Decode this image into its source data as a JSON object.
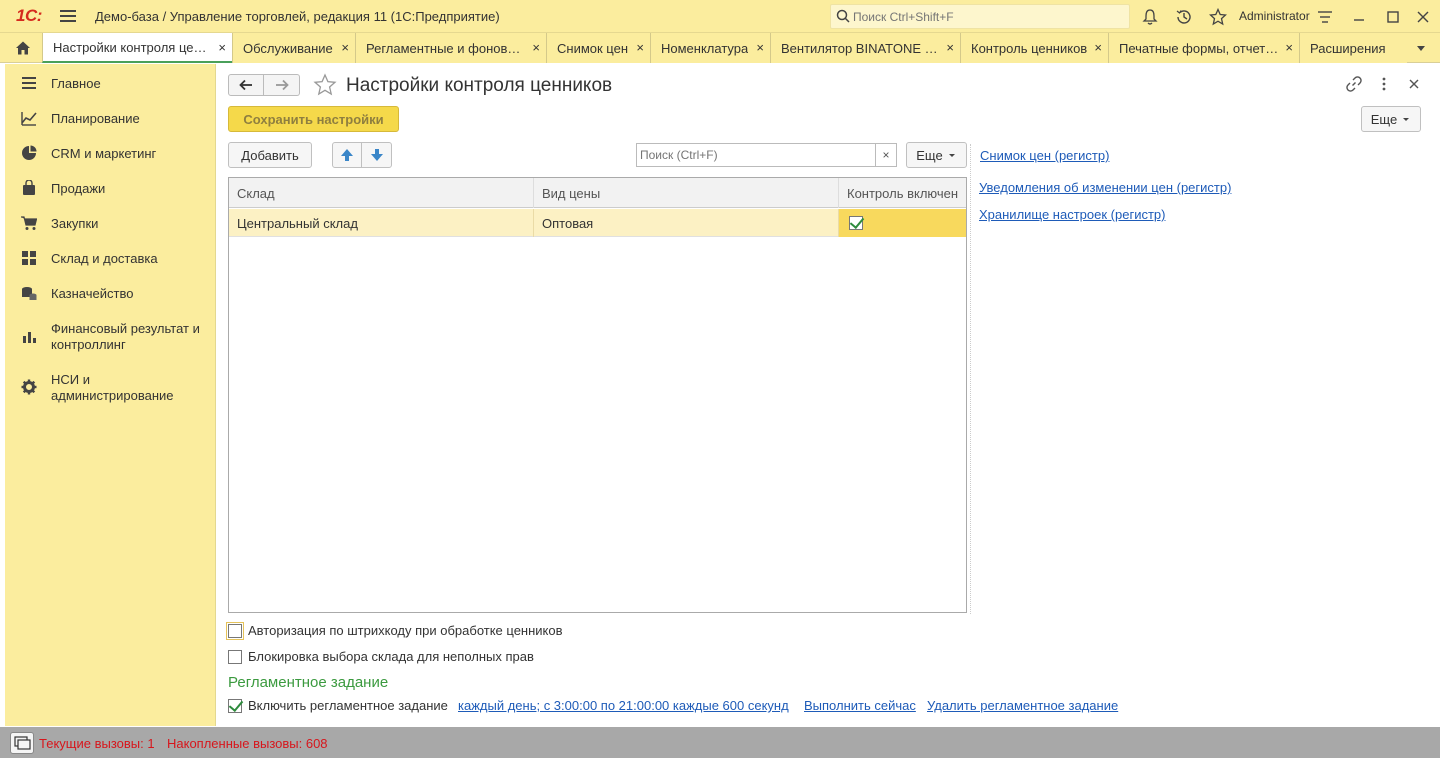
{
  "app": {
    "logo_text": "1С:",
    "title": "Демо-база / Управление торговлей, редакция 11  (1С:Предприятие)",
    "search_placeholder": "Поиск Ctrl+Shift+F",
    "user": "Administrator"
  },
  "tabs": [
    {
      "label": "Настройки контроля цен…",
      "active": true
    },
    {
      "label": "Обслуживание"
    },
    {
      "label": "Регламентные и фонов…"
    },
    {
      "label": "Снимок цен"
    },
    {
      "label": "Номенклатура"
    },
    {
      "label": "Вентилятор BINATONE …"
    },
    {
      "label": "Контроль ценников"
    },
    {
      "label": "Печатные формы, отчет…"
    },
    {
      "label": "Расширения"
    }
  ],
  "tab_close_glyph": "×",
  "sidebar": {
    "items": [
      {
        "label": "Главное",
        "icon": "list-icon"
      },
      {
        "label": "Планирование",
        "icon": "planning-icon"
      },
      {
        "label": "CRM и маркетинг",
        "icon": "crm-icon"
      },
      {
        "label": "Продажи",
        "icon": "bag-icon"
      },
      {
        "label": "Закупки",
        "icon": "cart-icon"
      },
      {
        "label": "Склад и доставка",
        "icon": "warehouse-icon"
      },
      {
        "label": "Казначейство",
        "icon": "coins-icon"
      },
      {
        "label": "Финансовый результат и контроллинг",
        "icon": "bar-chart-icon"
      },
      {
        "label": "НСИ и администрирование",
        "icon": "gear-icon"
      }
    ]
  },
  "form": {
    "title": "Настройки контроля ценников",
    "save_button": "Сохранить настройки",
    "more_button": "Еще",
    "add_button": "Добавить",
    "search_placeholder": "Поиск (Ctrl+F)",
    "clear_glyph": "×",
    "table": {
      "columns": [
        "Склад",
        "Вид цены",
        "Контроль включен"
      ],
      "rows": [
        {
          "warehouse": "Центральный склад",
          "price_type": "Оптовая",
          "control_enabled": true
        }
      ]
    },
    "links": [
      "Снимок цен (регистр)",
      "Уведомления об изменении цен (регистр)",
      "Хранилище настроек (регистр)"
    ],
    "options": [
      {
        "label": "Авторизация по штрихкоду при обработке ценников",
        "checked": false
      },
      {
        "label": "Блокировка выбора склада для неполных прав",
        "checked": false
      }
    ],
    "scheduled_task": {
      "section_title": "Регламентное задание",
      "enable_label": "Включить регламентное задание",
      "enabled": true,
      "schedule_link": "каждый день; с 3:00:00 по 21:00:00 каждые 600 секунд",
      "run_now_link": "Выполнить сейчас",
      "delete_link": "Удалить регламентное задание"
    }
  },
  "status": {
    "current_calls": "Текущие вызовы: 1",
    "accumulated_calls": "Накопленные вызовы: 608"
  },
  "colors": {
    "panel_yellow": "#fbed9e",
    "save_button": "#f5d94a",
    "link_blue": "#1e5bb8",
    "section_green": "#3b9a3f",
    "status_red": "#d7161c"
  }
}
